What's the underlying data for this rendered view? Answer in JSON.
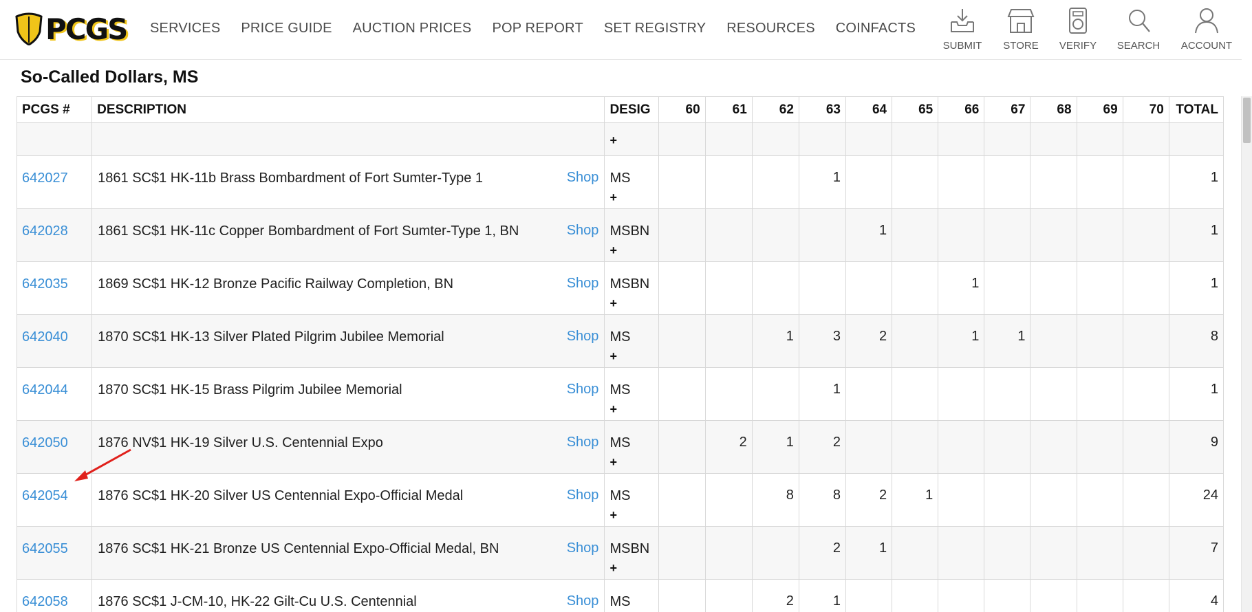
{
  "header": {
    "logo_text": "PCGS",
    "nav": [
      "SERVICES",
      "PRICE GUIDE",
      "AUCTION PRICES",
      "POP REPORT",
      "SET REGISTRY",
      "RESOURCES",
      "COINFACTS"
    ],
    "utilities": [
      {
        "label": "SUBMIT",
        "icon": "download-tray-icon"
      },
      {
        "label": "STORE",
        "icon": "storefront-icon"
      },
      {
        "label": "VERIFY",
        "icon": "coin-holder-icon"
      },
      {
        "label": "SEARCH",
        "icon": "search-icon"
      },
      {
        "label": "ACCOUNT",
        "icon": "user-icon"
      }
    ]
  },
  "page": {
    "title": "So-Called Dollars, MS"
  },
  "table": {
    "headers": {
      "pcgs": "PCGS #",
      "description": "DESCRIPTION",
      "desig": "DESIG",
      "grades": [
        "60",
        "61",
        "62",
        "63",
        "64",
        "65",
        "66",
        "67",
        "68",
        "69",
        "70"
      ],
      "total": "TOTAL"
    },
    "shop_label": "Shop",
    "expand_symbol": "+",
    "rows": [
      {
        "pcgs": "642027",
        "description": "1861 SC$1 HK-11b Brass Bombardment of Fort Sumter-Type 1",
        "desig": "MS",
        "counts": [
          "",
          "",
          "",
          "1",
          "",
          "",
          "",
          "",
          "",
          "",
          ""
        ],
        "total": "1"
      },
      {
        "pcgs": "642028",
        "description": "1861 SC$1 HK-11c Copper Bombardment of Fort Sumter-Type 1, BN",
        "desig": "MSBN",
        "counts": [
          "",
          "",
          "",
          "",
          "1",
          "",
          "",
          "",
          "",
          "",
          ""
        ],
        "total": "1"
      },
      {
        "pcgs": "642035",
        "description": "1869 SC$1 HK-12 Bronze Pacific Railway Completion, BN",
        "desig": "MSBN",
        "counts": [
          "",
          "",
          "",
          "",
          "",
          "",
          "1",
          "",
          "",
          "",
          ""
        ],
        "total": "1"
      },
      {
        "pcgs": "642040",
        "description": "1870 SC$1 HK-13 Silver Plated Pilgrim Jubilee Memorial",
        "desig": "MS",
        "counts": [
          "",
          "",
          "1",
          "3",
          "2",
          "",
          "1",
          "1",
          "",
          "",
          ""
        ],
        "total": "8"
      },
      {
        "pcgs": "642044",
        "description": "1870 SC$1 HK-15 Brass Pilgrim Jubilee Memorial",
        "desig": "MS",
        "counts": [
          "",
          "",
          "",
          "1",
          "",
          "",
          "",
          "",
          "",
          "",
          ""
        ],
        "total": "1"
      },
      {
        "pcgs": "642050",
        "description": "1876 NV$1 HK-19 Silver U.S. Centennial Expo",
        "desig": "MS",
        "counts": [
          "",
          "2",
          "1",
          "2",
          "",
          "",
          "",
          "",
          "",
          "",
          ""
        ],
        "total": "9"
      },
      {
        "pcgs": "642054",
        "description": "1876 SC$1 HK-20 Silver US Centennial Expo-Official Medal",
        "desig": "MS",
        "counts": [
          "",
          "",
          "8",
          "8",
          "2",
          "1",
          "",
          "",
          "",
          "",
          ""
        ],
        "total": "24"
      },
      {
        "pcgs": "642055",
        "description": "1876 SC$1 HK-21 Bronze US Centennial Expo-Official Medal, BN",
        "desig": "MSBN",
        "counts": [
          "",
          "",
          "",
          "2",
          "1",
          "",
          "",
          "",
          "",
          "",
          ""
        ],
        "total": "7"
      },
      {
        "pcgs": "642058",
        "description": "1876 SC$1 J-CM-10, HK-22 Gilt-Cu U.S. Centennial",
        "desig": "MS",
        "counts": [
          "",
          "",
          "2",
          "1",
          "",
          "",
          "",
          "",
          "",
          "",
          ""
        ],
        "total": "4"
      }
    ]
  },
  "colors": {
    "link": "#3a8fd6",
    "logo_yellow": "#f0c419",
    "annotation_arrow": "#e0201b"
  }
}
